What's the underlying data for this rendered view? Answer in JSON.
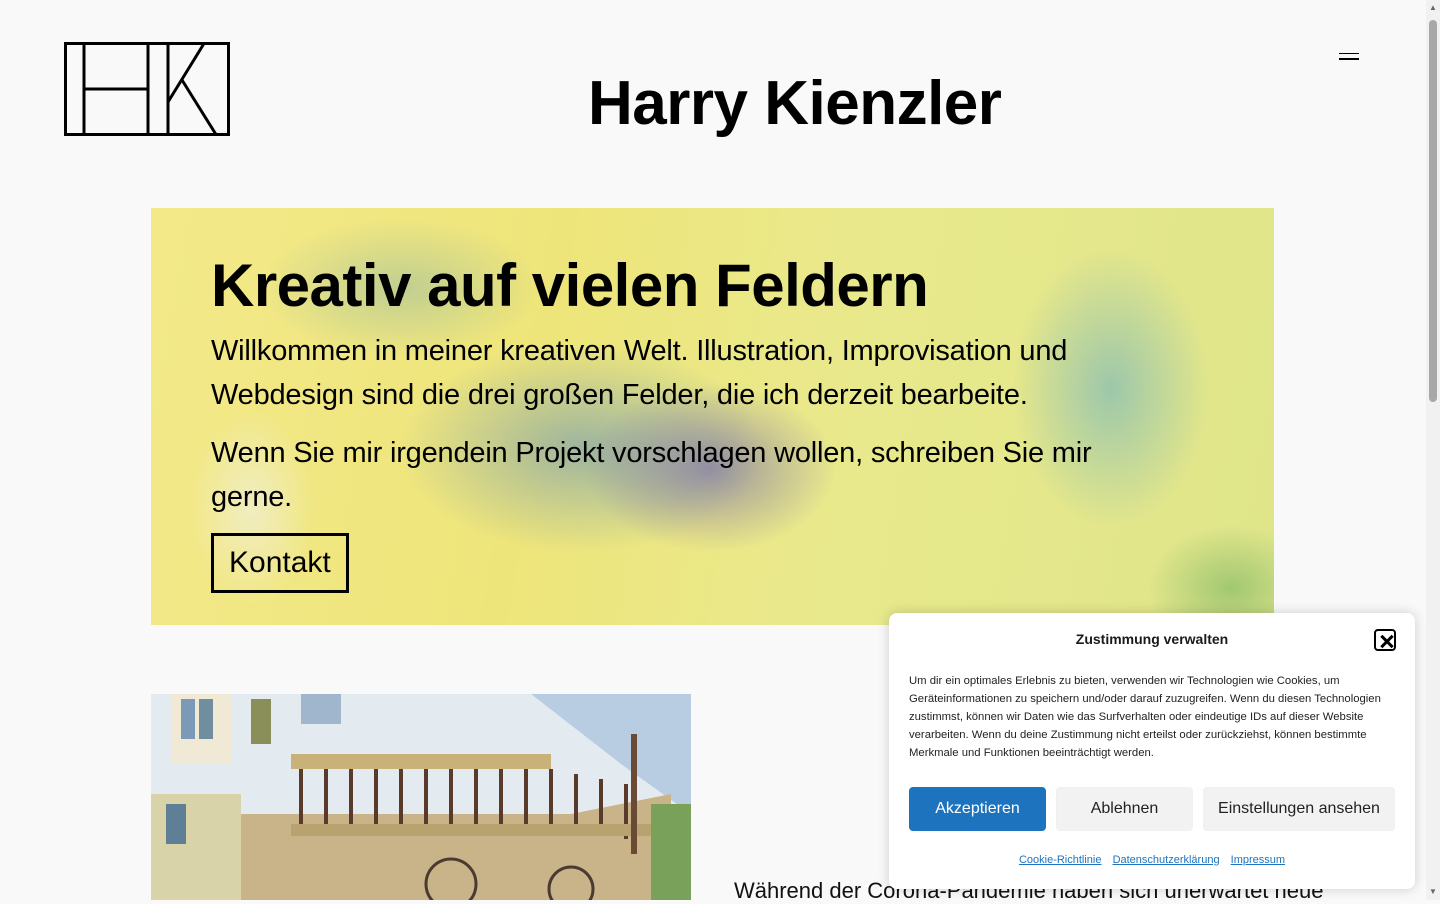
{
  "header": {
    "site_title": "Harry Kienzler"
  },
  "hero": {
    "heading": "Kreativ auf vielen Feldern",
    "paragraph1": "Willkommen in meiner kreativen Welt. Illustration, Improvisation und Webdesign sind die drei großen Felder, die ich derzeit bearbeite.",
    "paragraph2": "Wenn Sie mir irgendein Projekt vorschlagen wollen, schreiben Sie mir gerne.",
    "button_label": "Kontakt"
  },
  "content": {
    "text_partial": "Während der Corona-Pandemie haben sich unerwartet neue"
  },
  "cookie_banner": {
    "title": "Zustimmung verwalten",
    "text": "Um dir ein optimales Erlebnis zu bieten, verwenden wir Technologien wie Cookies, um Geräteinformationen zu speichern und/oder darauf zuzugreifen. Wenn du diesen Technologien zustimmst, können wir Daten wie das Surfverhalten oder eindeutige IDs auf dieser Website verarbeiten. Wenn du deine Zustimmung nicht erteilst oder zurückziehst, können bestimmte Merkmale und Funktionen beeinträchtigt werden.",
    "accept_label": "Akzeptieren",
    "deny_label": "Ablehnen",
    "settings_label": "Einstellungen ansehen",
    "links": [
      "Cookie-Richtlinie",
      "Datenschutzerklärung",
      "Impressum"
    ]
  },
  "colors": {
    "accent": "#1e73be",
    "background": "#f9f9f9"
  }
}
